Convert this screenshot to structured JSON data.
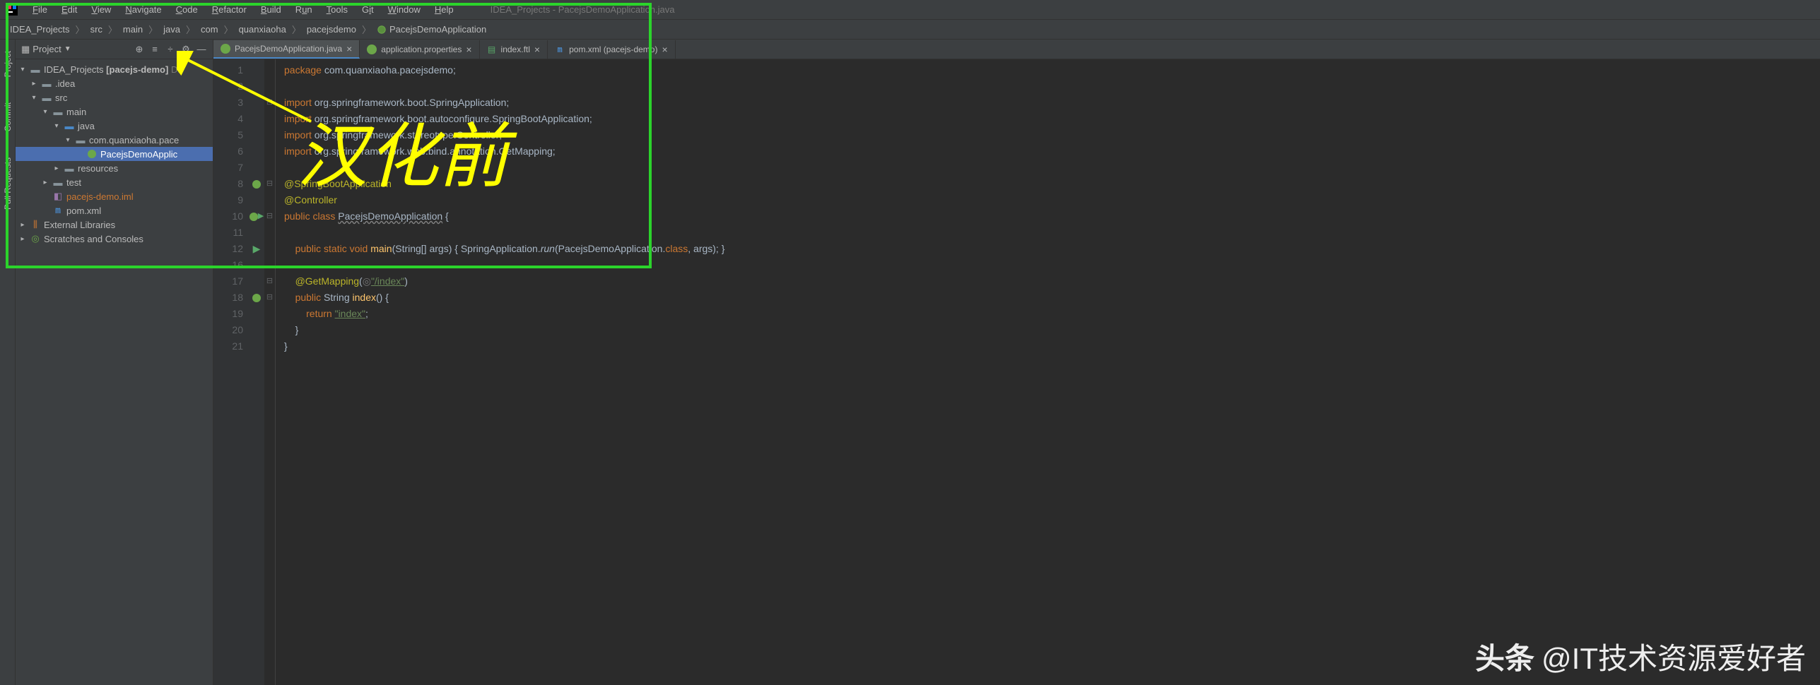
{
  "menu": {
    "items": [
      "File",
      "Edit",
      "View",
      "Navigate",
      "Code",
      "Refactor",
      "Build",
      "Run",
      "Tools",
      "Git",
      "Window",
      "Help"
    ],
    "title": "IDEA_Projects - PacejsDemoApplication.java"
  },
  "breadcrumb": {
    "items": [
      "IDEA_Projects",
      "src",
      "main",
      "java",
      "com",
      "quanxiaoha",
      "pacejsdemo",
      "PacejsDemoApplication"
    ]
  },
  "gutter_tabs": {
    "project": "Project",
    "commit": "Commit",
    "pull_requests": "Pull Requests"
  },
  "panel": {
    "title": "Project"
  },
  "tree": {
    "root": "IDEA_Projects",
    "root_suffix": "[pacejs-demo]",
    "root_path": "D:\\",
    "idea": ".idea",
    "src": "src",
    "main": "main",
    "java": "java",
    "pkg": "com.quanxiaoha.pace",
    "app": "PacejsDemoApplic",
    "resources": "resources",
    "test": "test",
    "iml": "pacejs-demo.iml",
    "pom": "pom.xml",
    "ext_lib": "External Libraries",
    "scratches": "Scratches and Consoles"
  },
  "tabs": [
    {
      "label": "PacejsDemoApplication.java",
      "active": true,
      "icon": "spring"
    },
    {
      "label": "application.properties",
      "active": false,
      "icon": "spring"
    },
    {
      "label": "index.ftl",
      "active": false,
      "icon": "ftl"
    },
    {
      "label": "pom.xml (pacejs-demo)",
      "active": false,
      "icon": "m"
    }
  ],
  "code": {
    "package_kw": "package",
    "package_val": "com.quanxiaoha.pacejsdemo;",
    "import_kw": "import",
    "import1": "org.springframework.boot.SpringApplication;",
    "import2": "org.springframework.boot.autoconfigure.SpringBootApplication;",
    "import3": "org.springframework.stereotype.Controller;",
    "import4": "org.springframework.web.bind.annotation.GetMapping;",
    "anno1": "@SpringBootApplication",
    "anno2": "@Controller",
    "public_kw": "public",
    "class_kw": "class",
    "class_name": "PacejsDemoApplication",
    "static_kw": "static",
    "void_kw": "void",
    "main_method": "main",
    "main_params": "(String[] args)",
    "main_body1": "SpringApplication.",
    "main_run": "run",
    "main_body2": "(PacejsDemoApplication.",
    "main_body3": ", args); }",
    "class_ref": "class",
    "getmapping": "@GetMapping",
    "getmapping_path": "\"/index\"",
    "index_method": "index",
    "return_kw": "return",
    "return_val": "\"index\"",
    "string_type": "String"
  },
  "line_numbers": [
    "1",
    "2",
    "3",
    "4",
    "5",
    "6",
    "7",
    "8",
    "9",
    "10",
    "11",
    "12",
    "",
    "16",
    "17",
    "18",
    "19",
    "20",
    "21"
  ],
  "overlay": {
    "text": "汉化前"
  },
  "watermark": {
    "logo": "头条",
    "text": "@IT技术资源爱好者"
  }
}
